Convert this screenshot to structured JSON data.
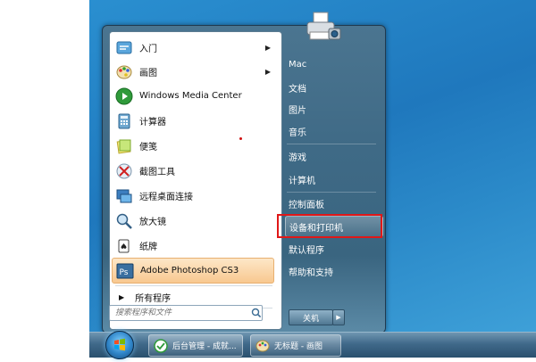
{
  "start_menu": {
    "programs": [
      {
        "label": "入门",
        "icon": "getting-started-icon",
        "has_submenu": true
      },
      {
        "label": "画图",
        "icon": "paint-icon",
        "has_submenu": true
      },
      {
        "label": "Windows Media Center",
        "icon": "media-center-icon",
        "has_submenu": false
      },
      {
        "label": "计算器",
        "icon": "calculator-icon",
        "has_submenu": false
      },
      {
        "label": "便笺",
        "icon": "sticky-notes-icon",
        "has_submenu": false
      },
      {
        "label": "截图工具",
        "icon": "snipping-tool-icon",
        "has_submenu": false
      },
      {
        "label": "远程桌面连接",
        "icon": "remote-desktop-icon",
        "has_submenu": false
      },
      {
        "label": "放大镜",
        "icon": "magnifier-icon",
        "has_submenu": false
      },
      {
        "label": "纸牌",
        "icon": "solitaire-icon",
        "has_submenu": false
      },
      {
        "label": "Adobe Photoshop CS3",
        "icon": "photoshop-icon",
        "has_submenu": false,
        "highlighted": true
      }
    ],
    "all_programs_label": "所有程序",
    "search_placeholder": "搜索程序和文件",
    "right_items": [
      {
        "label": "Mac"
      },
      {
        "label": "文档"
      },
      {
        "label": "图片"
      },
      {
        "label": "音乐"
      },
      {
        "label": "游戏"
      },
      {
        "label": "计算机"
      },
      {
        "label": "控制面板"
      },
      {
        "label": "设备和打印机",
        "highlighted": true
      },
      {
        "label": "默认程序"
      },
      {
        "label": "帮助和支持"
      }
    ],
    "shutdown_label": "关机"
  },
  "taskbar": {
    "buttons": [
      {
        "label": "后台管理 - 成就...",
        "icon": "browser-icon"
      },
      {
        "label": "无标题 - 画图",
        "icon": "paint-icon"
      }
    ]
  },
  "colors": {
    "highlight_box": "#e01818",
    "desktop": "#1f78bd",
    "taskbar": "#2a506e"
  }
}
